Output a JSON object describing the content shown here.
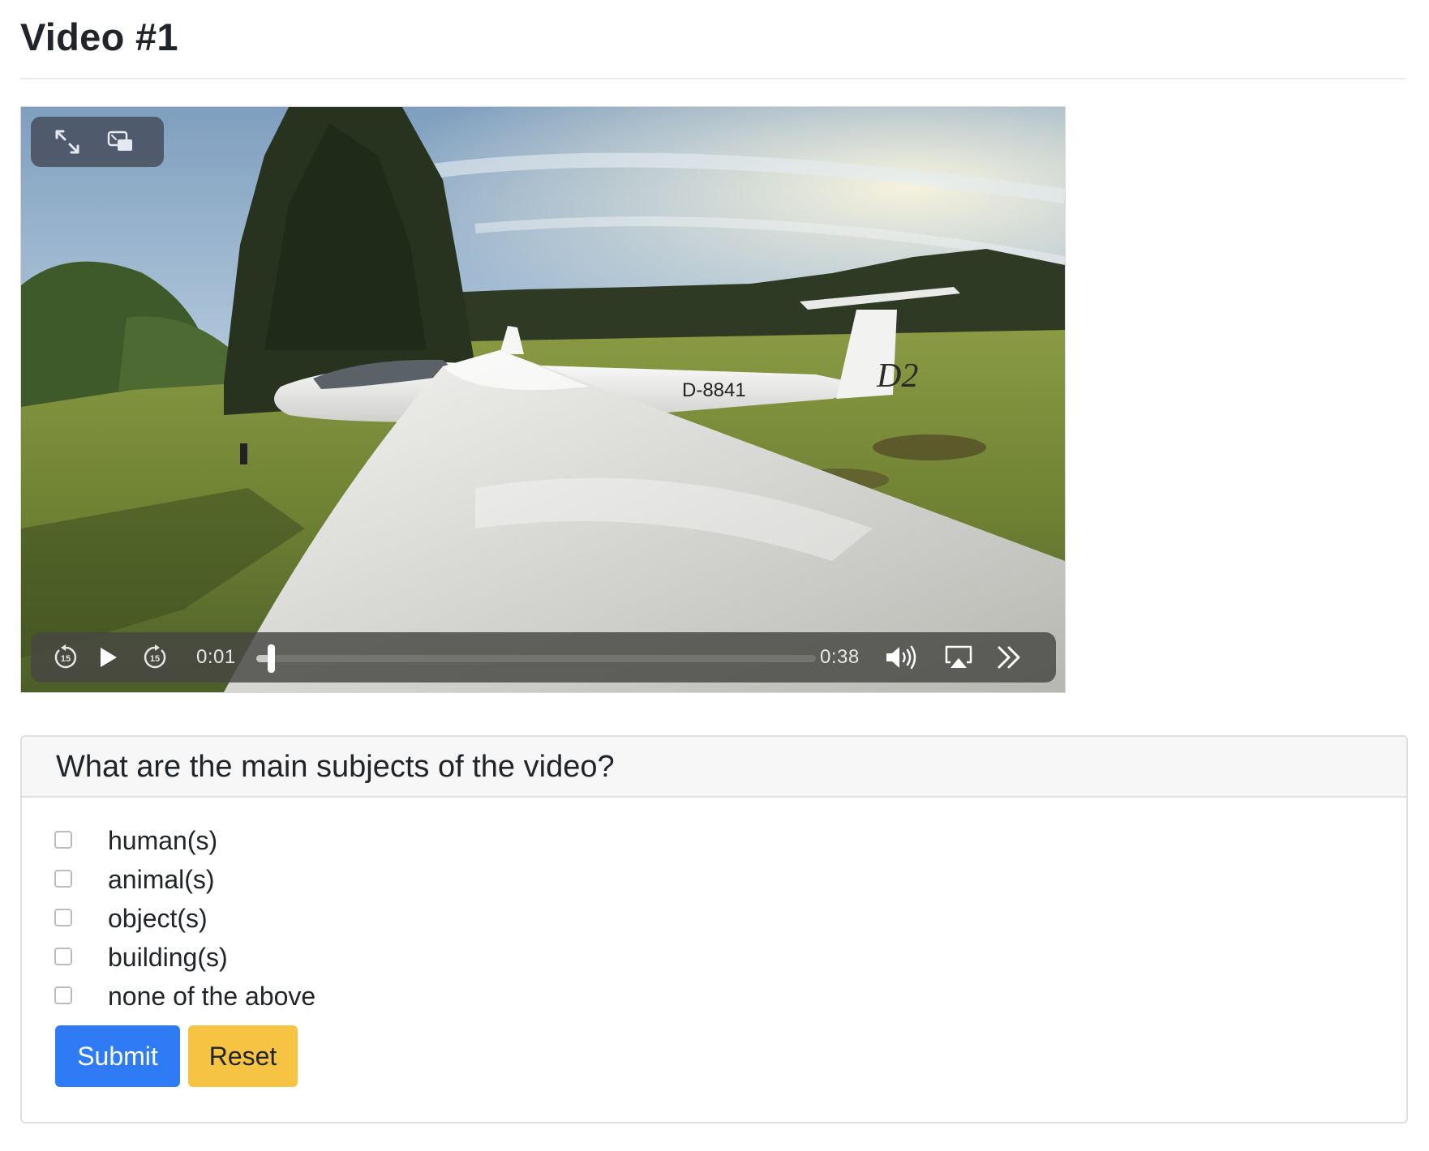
{
  "page": {
    "title": "Video #1"
  },
  "video": {
    "aircraft_registration": "D-8841",
    "tail_marking": "D2",
    "current_time": "0:01",
    "duration": "0:38",
    "progress_fraction": 0.026,
    "icons": {
      "fullscreen": "expand-arrows-icon",
      "pip": "picture-in-picture-icon",
      "skip_back": "skip-back-15-icon",
      "play": "play-icon",
      "skip_forward": "skip-forward-15-icon",
      "volume": "volume-icon",
      "airplay": "airplay-icon",
      "more": "double-chevron-right-icon"
    },
    "skip_seconds_label": "15"
  },
  "question": {
    "prompt": "What are the main subjects of the video?",
    "options": [
      {
        "label": "human(s)",
        "checked": false
      },
      {
        "label": "animal(s)",
        "checked": false
      },
      {
        "label": "object(s)",
        "checked": false
      },
      {
        "label": "building(s)",
        "checked": false
      },
      {
        "label": "none of the above",
        "checked": false
      }
    ],
    "submit_label": "Submit",
    "reset_label": "Reset"
  },
  "colors": {
    "submit": "#2f7bf6",
    "reset": "#f7c343",
    "header_bg": "#f7f7f7"
  }
}
